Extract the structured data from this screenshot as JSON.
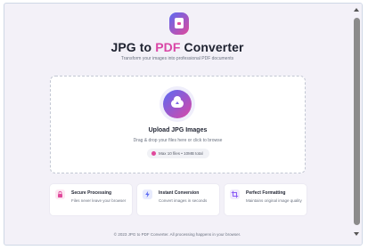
{
  "header": {
    "title_part1": "JPG to ",
    "title_accent": "PDF",
    "title_part2": " Converter",
    "subtitle": "Transform your images into professional PDF documents",
    "logo_icon": "pdf-document-icon"
  },
  "upload": {
    "title": "Upload JPG Images",
    "hint": "Drag & drop your files here or click to browse",
    "limit": "Max 10 files • 10MB total",
    "icon": "cloud-upload-icon"
  },
  "features": [
    {
      "title": "Secure Processing",
      "desc": "Files never leave your browser",
      "icon": "lock-icon",
      "color": "#e0499b",
      "bg": "#fde7f2"
    },
    {
      "title": "Instant Conversion",
      "desc": "Convert images in seconds",
      "icon": "lightning-icon",
      "color": "#5b6bf3",
      "bg": "#e8ebfd"
    },
    {
      "title": "Perfect Formatting",
      "desc": "Maintains original image quality",
      "icon": "crop-icon",
      "color": "#8b5cf6",
      "bg": "#efe8fd"
    }
  ],
  "footer": "© 2023 JPG to PDF Converter. All processing happens in your browser.",
  "colors": {
    "accent": "#d946a6",
    "primary": "#5b6bf3"
  }
}
